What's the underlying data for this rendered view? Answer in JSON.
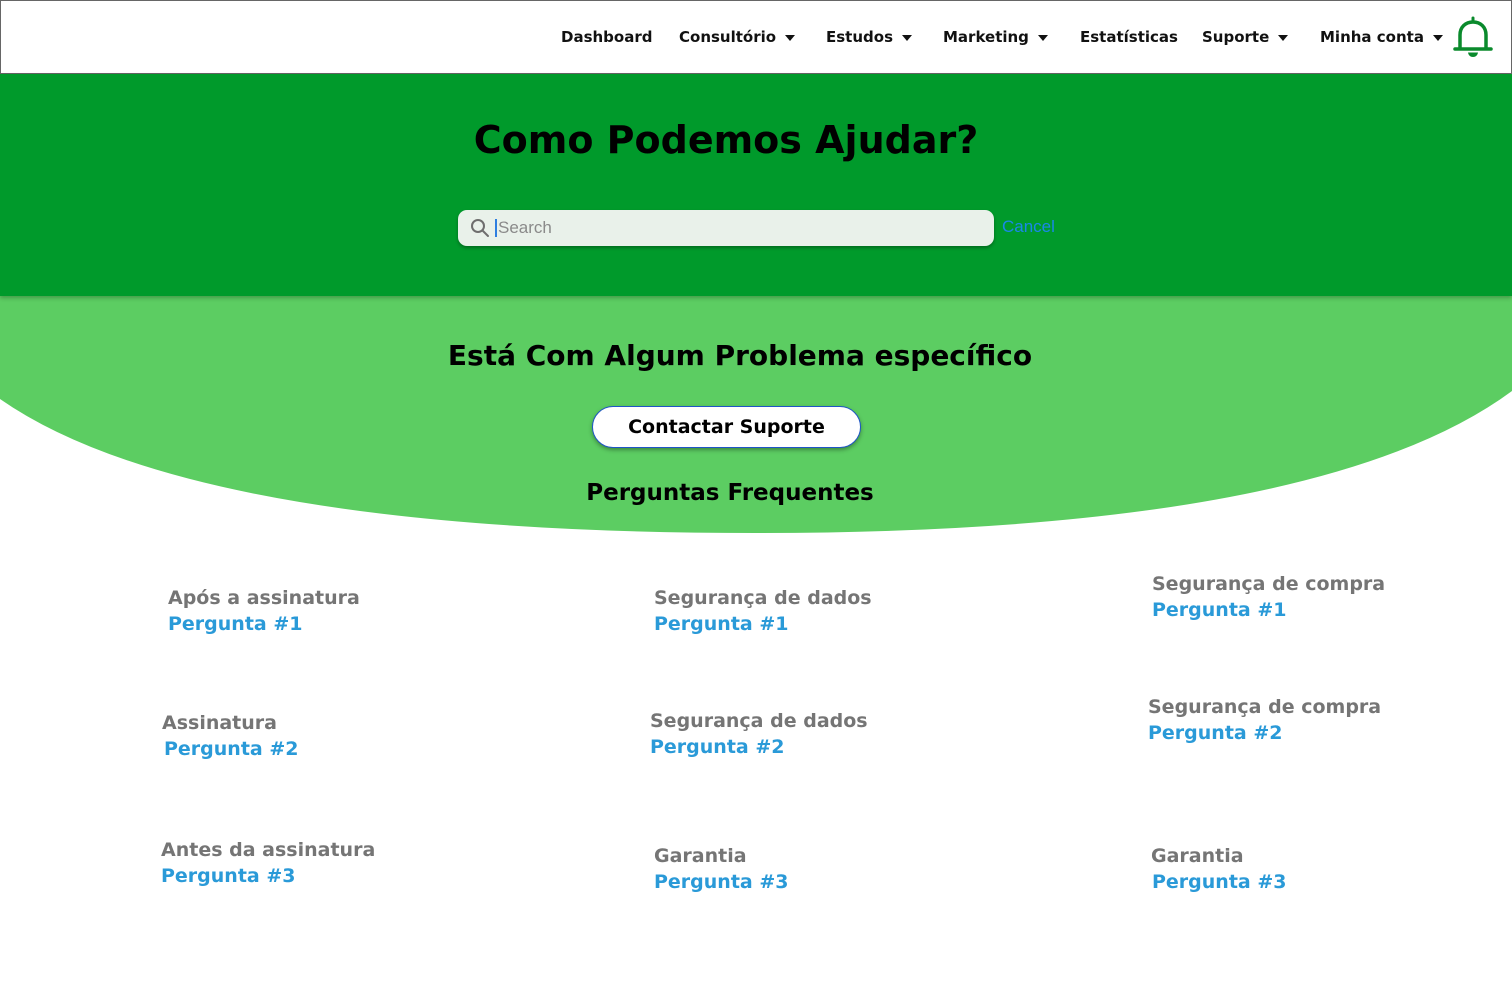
{
  "nav": {
    "items": [
      {
        "label": "Dashboard",
        "dropdown": false
      },
      {
        "label": "Consultório",
        "dropdown": true
      },
      {
        "label": "Estudos",
        "dropdown": true
      },
      {
        "label": "Marketing",
        "dropdown": true
      },
      {
        "label": "Estatísticas",
        "dropdown": false
      },
      {
        "label": "Suporte",
        "dropdown": true
      },
      {
        "label": "Minha conta",
        "dropdown": true
      }
    ],
    "notification_icon": "bell-icon"
  },
  "hero": {
    "title": "Como Podemos Ajudar?",
    "search_placeholder": "Search",
    "search_value": "",
    "cancel_label": "Cancel"
  },
  "problem": {
    "title": "Está Com Algum Problema específico",
    "button_label": "Contactar Suporte"
  },
  "faq": {
    "title": "Perguntas Frequentes",
    "items": [
      {
        "category": "Após a assinatura",
        "question": "Pergunta #1"
      },
      {
        "category": "Segurança de dados",
        "question": "Pergunta #1"
      },
      {
        "category": "Segurança de compra",
        "question": "Pergunta #1"
      },
      {
        "category": "Assinatura",
        "question": "Pergunta #2"
      },
      {
        "category": "Segurança de dados",
        "question": "Pergunta #2"
      },
      {
        "category": "Segurança de compra",
        "question": "Pergunta #2"
      },
      {
        "category": "Antes da assinatura",
        "question": "Pergunta #3"
      },
      {
        "category": "Garantia",
        "question": "Pergunta #3"
      },
      {
        "category": "Garantia",
        "question": "Pergunta #3"
      }
    ]
  },
  "colors": {
    "hero_green": "#009a2b",
    "band_green": "#5ccd62",
    "question_blue": "#2a9ad8",
    "category_gray": "#757575",
    "bell_green": "#0a8a2c"
  }
}
